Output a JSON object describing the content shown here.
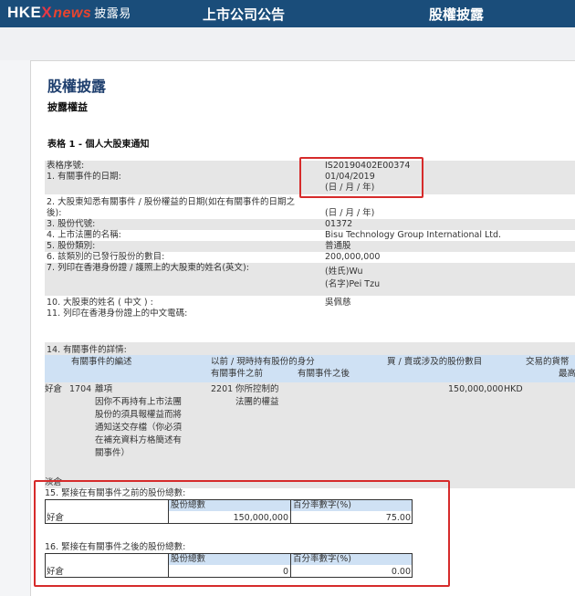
{
  "header": {
    "logo_hkex": "HKE",
    "logo_x": "X",
    "logo_news": "news",
    "logo_tc": "披露易",
    "nav": [
      "上市公司公告",
      "股權披露"
    ]
  },
  "page": {
    "title": "股權披露",
    "subtitle": "披露權益",
    "section": "表格 1 - 個人大股東通知"
  },
  "fields": {
    "form_no_label": "表格序號:",
    "form_no_value": "IS20190402E00374",
    "event_date_label": "1. 有關事件的日期:",
    "event_date_value": "01/04/2019",
    "event_date_fmt": "(日 / 月 / 年)",
    "aware_label": "2. 大股東知悉有關事件 / 股份權益的日期(如在有關事件的日期之",
    "aware_label2": "後):",
    "aware_value": "(日 / 月 / 年)",
    "stock_code_label": "3. 股份代號:",
    "stock_code_value": "01372",
    "corp_name_label": "4. 上市法團的名稱:",
    "corp_name_value": "Bisu Technology Group International Ltd.",
    "share_class_label": "5. 股份類別:",
    "share_class_value": "普通股",
    "issued_label": "6. 該類別的已發行股份的數目:",
    "issued_value": "200,000,000",
    "eng_name_label": "7. 列印在香港身份證 / 護照上的大股東的姓名(英文):",
    "surname_value": "(姓氏)Wu",
    "given_value": "(名字)Pei Tzu",
    "chn_name_label": "10. 大股東的姓名 ( 中文 ) :",
    "chn_name_value": "吳佩慈",
    "cc_label": "11. 列印在香港身份證上的中文電碼:"
  },
  "event": {
    "section_label": "14. 有關事件的詳情:",
    "col_event_code": "有關事件的編述",
    "col_capacity": "以前 / 現時持有股份的身分",
    "col_before": "有關事件之前",
    "col_after": "有關事件之後",
    "col_shares": "買 / 賣或涉及的股份數目",
    "col_currency": "交易的貨幣",
    "col_highest": "最高",
    "position": "好倉",
    "code": "1704",
    "desc_lines": [
      "離項",
      "因你不再持有上市法團",
      "股份的須具報權益而將",
      "通知送交存檔（你必須",
      "在補充資料方格簡述有",
      "關事件）"
    ],
    "cap_code": "2201",
    "cap_lines": [
      "你所控制的",
      "法團的權益"
    ],
    "shares": "150,000,000",
    "currency": "HKD"
  },
  "short_label": "淡倉",
  "before_block": {
    "label": "15. 緊接在有關事件之前的股份總數:",
    "col_shares": "股份總數",
    "col_pct": "百分率數字(%)",
    "row_label": "好倉",
    "shares": "150,000,000",
    "pct": "75.00"
  },
  "after_block": {
    "label": "16. 緊接在有關事件之後的股份總數:",
    "col_shares": "股份總數",
    "col_pct": "百分率數字(%)",
    "row_label": "好倉",
    "shares": "0",
    "pct": "0.00"
  },
  "colors": {
    "topbar": "#1a4d7a",
    "highlight": "#d62b2b",
    "title": "#1f3f6e"
  }
}
